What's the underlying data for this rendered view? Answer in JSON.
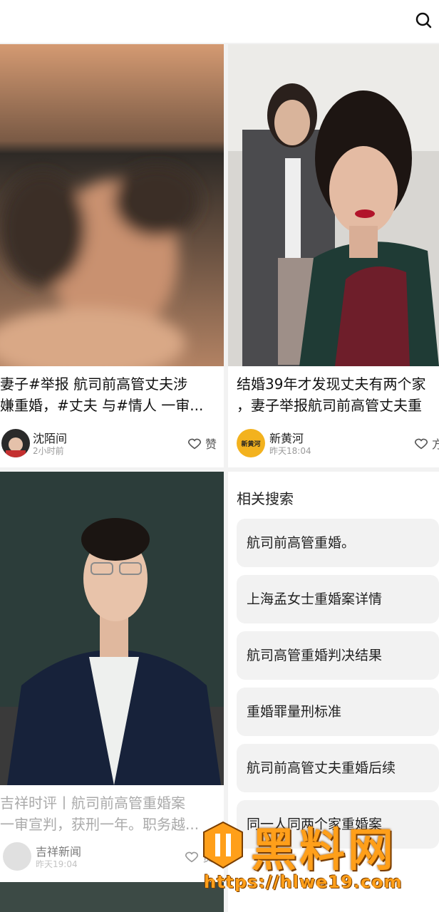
{
  "cards": [
    {
      "title_line1": "妻子#举报 航司前高管丈夫涉",
      "title_line2": "嫌重婚，#丈夫 与#情人 一审...",
      "author": "沈陌间",
      "time": "2小时前",
      "like_label": "赞",
      "image_desc": "blurred-photo"
    },
    {
      "title_line1": "结婚39年才发现丈夫有两个家",
      "title_line2": "，妻子举报航司前高管丈夫重",
      "author": "新黄河",
      "time": "昨天18:04",
      "like_label": "方",
      "avatar_text": "新黄河"
    },
    {
      "title_line1": "吉祥时评丨航司前高管重婚案",
      "title_line2": "一审宣判，获刑一年。职务越...",
      "author": "吉祥新闻",
      "time": "昨天19:04",
      "like_label": "赞"
    }
  ],
  "related": {
    "title": "相关搜索",
    "items": [
      "航司前高管重婚。",
      "上海孟女士重婚案详情",
      "航司高管重婚判决结果",
      "重婚罪量刑标准",
      "航司前高管丈夫重婚后续",
      "同一人同两个家重婚案"
    ]
  },
  "watermark": {
    "text": "黑料网",
    "url": "https://hlwe19.com"
  },
  "colors": {
    "watermark": "#ff9f1a",
    "card_bg": "#ffffff",
    "page_bg": "#f2f2f2",
    "chip_bg": "#f2f2f2"
  }
}
